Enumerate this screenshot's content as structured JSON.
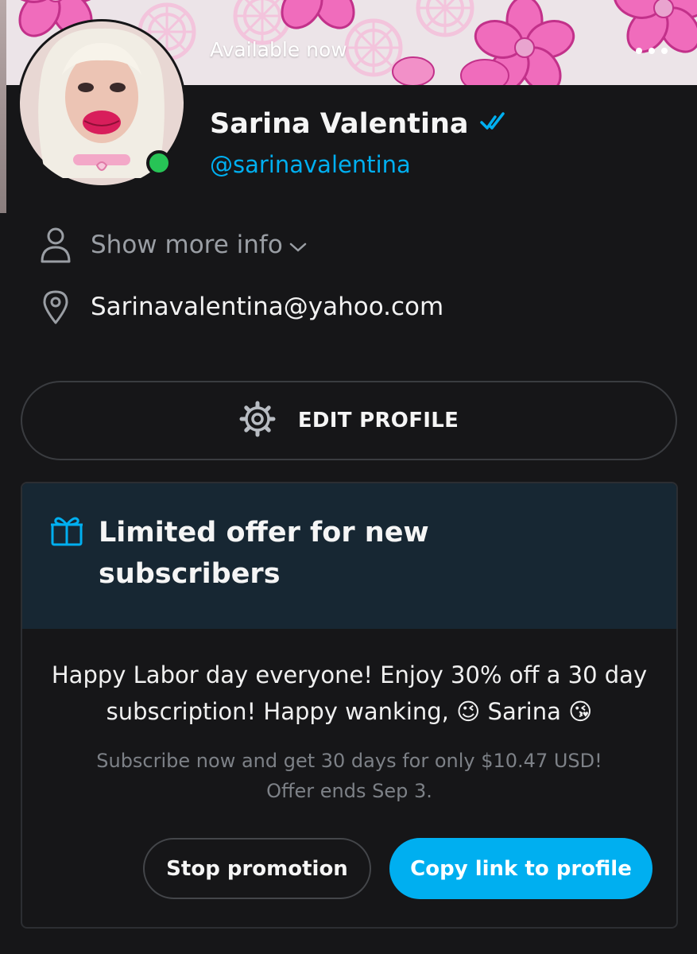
{
  "profile": {
    "status": "Available now",
    "name": "Sarina Valentina",
    "handle": "@sarinavalentina",
    "verified_color": "#00aff0",
    "online_color": "#27c456"
  },
  "info": {
    "show_more_label": "Show more info",
    "location": "Sarinavalentina@yahoo.com"
  },
  "actions": {
    "edit_profile_label": "EDIT PROFILE"
  },
  "offer": {
    "title": "Limited offer for new subscribers",
    "message": "Happy Labor day everyone! Enjoy 30% off a 30 day subscription! Happy wanking, 😉 Sarina 😘",
    "subtext_line1": "Subscribe now and get 30 days for only $10.47 USD!",
    "subtext_line2": "Offer ends Sep 3.",
    "stop_label": "Stop promotion",
    "copy_label": "Copy link to profile"
  },
  "icons": {
    "menu": "more-dots-icon",
    "verified": "verified-check-icon",
    "person": "person-icon",
    "location": "location-pin-icon",
    "settings": "gear-icon",
    "gift": "gift-icon"
  },
  "colors": {
    "background": "#161618",
    "accent": "#00aff0",
    "offer_header": "#172733",
    "muted_text": "#7d8187"
  }
}
